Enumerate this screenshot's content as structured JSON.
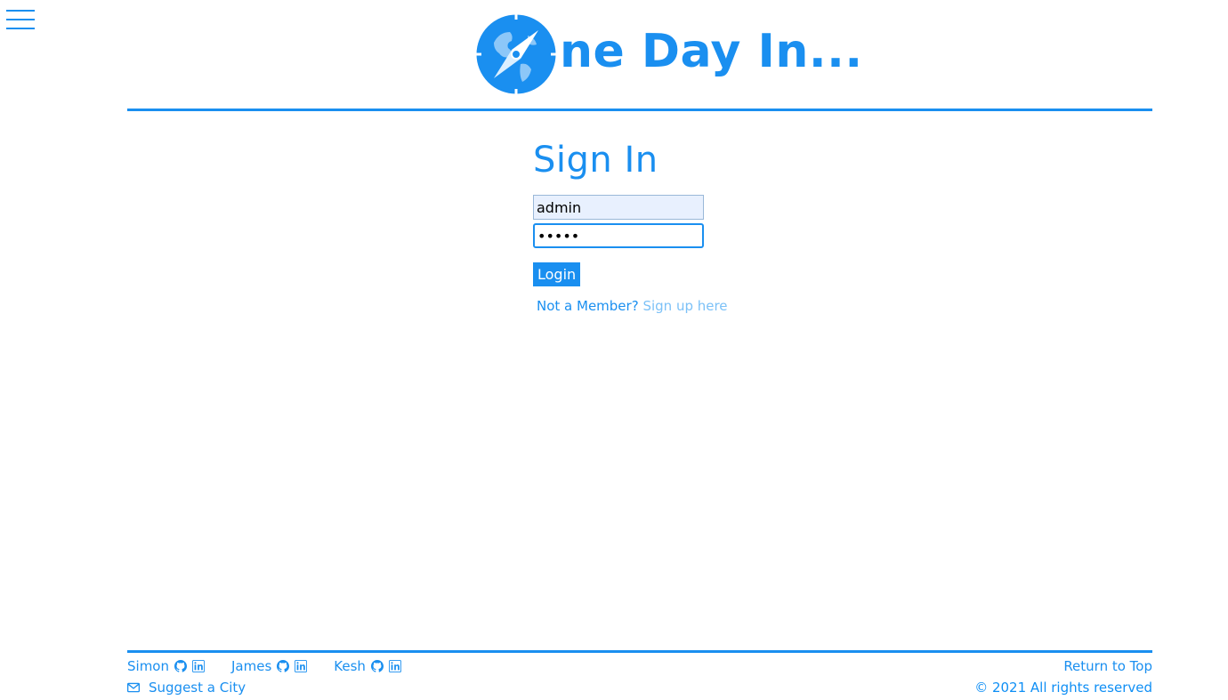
{
  "nav": {
    "menu_icon": "hamburger-icon"
  },
  "header": {
    "logo_icon": "compass-globe-icon",
    "title": "ne Day In..."
  },
  "signin": {
    "heading": "Sign In",
    "username_value": "admin",
    "password_value": "•••••",
    "login_label": "Login",
    "member_text": "Not a Member?",
    "signup_link": "Sign up here"
  },
  "footer": {
    "people": [
      {
        "name": "Simon",
        "icons": [
          "github-icon",
          "linkedin-icon"
        ]
      },
      {
        "name": "James",
        "icons": [
          "github-icon",
          "linkedin-icon"
        ]
      },
      {
        "name": "Kesh",
        "icons": [
          "github-icon",
          "linkedin-icon"
        ]
      }
    ],
    "suggest_label": "Suggest a City",
    "suggest_icon": "envelope-icon",
    "return_top": "Return to Top",
    "copyright": "© 2021 All rights reserved"
  },
  "colors": {
    "accent": "#1a8ff0",
    "link_light": "#7cc1f7",
    "autofill_bg": "#e8f0fe"
  }
}
